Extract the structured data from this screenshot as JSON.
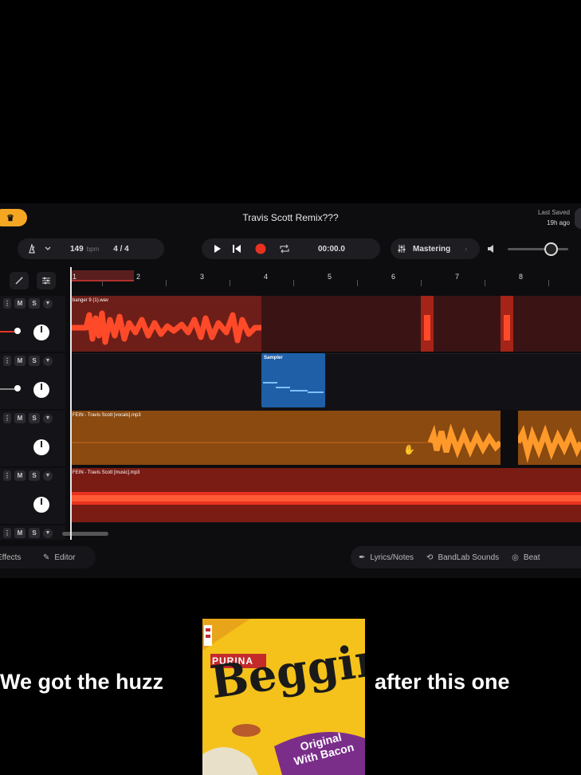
{
  "header": {
    "project_title": "Travis Scott Remix???",
    "last_saved_label": "Last Saved",
    "last_saved_value": "19h ago",
    "badge_icon": "crown-icon"
  },
  "transport": {
    "tempo_value": "149",
    "tempo_unit": "bpm",
    "time_signature": "4 / 4",
    "time_display": "00:00.0",
    "mastering_label": "Mastering",
    "volume_level": 0.75
  },
  "ruler": {
    "bars": [
      "1",
      "2",
      "3",
      "4",
      "5",
      "6",
      "7",
      "8"
    ]
  },
  "tracks": [
    {
      "clip_name": "banger 9 (1).wav",
      "mute": "M",
      "solo": "S",
      "color": "#e8331f"
    },
    {
      "clip_name": "Sampler",
      "mute": "M",
      "solo": "S",
      "color": "#1e6fc4"
    },
    {
      "clip_name": "FEIN - Travis Scott [vocals].mp3",
      "mute": "M",
      "solo": "S",
      "color": "#e07a12"
    },
    {
      "clip_name": "FEIN - Travis Scott [music].mp3",
      "mute": "M",
      "solo": "S",
      "color": "#d82e1a"
    },
    {
      "clip_name": "",
      "mute": "M",
      "solo": "S",
      "color": "#333"
    }
  ],
  "footer": {
    "effects_label": "Effects",
    "editor_label": "Editor",
    "lyrics_label": "Lyrics/Notes",
    "sounds_label": "BandLab Sounds",
    "beat_label": "Beat"
  },
  "caption": {
    "left_text": "We got the huzz",
    "right_text": "after this one"
  },
  "product": {
    "brand": "PURINA",
    "name": "Beggin'",
    "flavor_line1": "Original",
    "flavor_line2": "With Bacon"
  }
}
